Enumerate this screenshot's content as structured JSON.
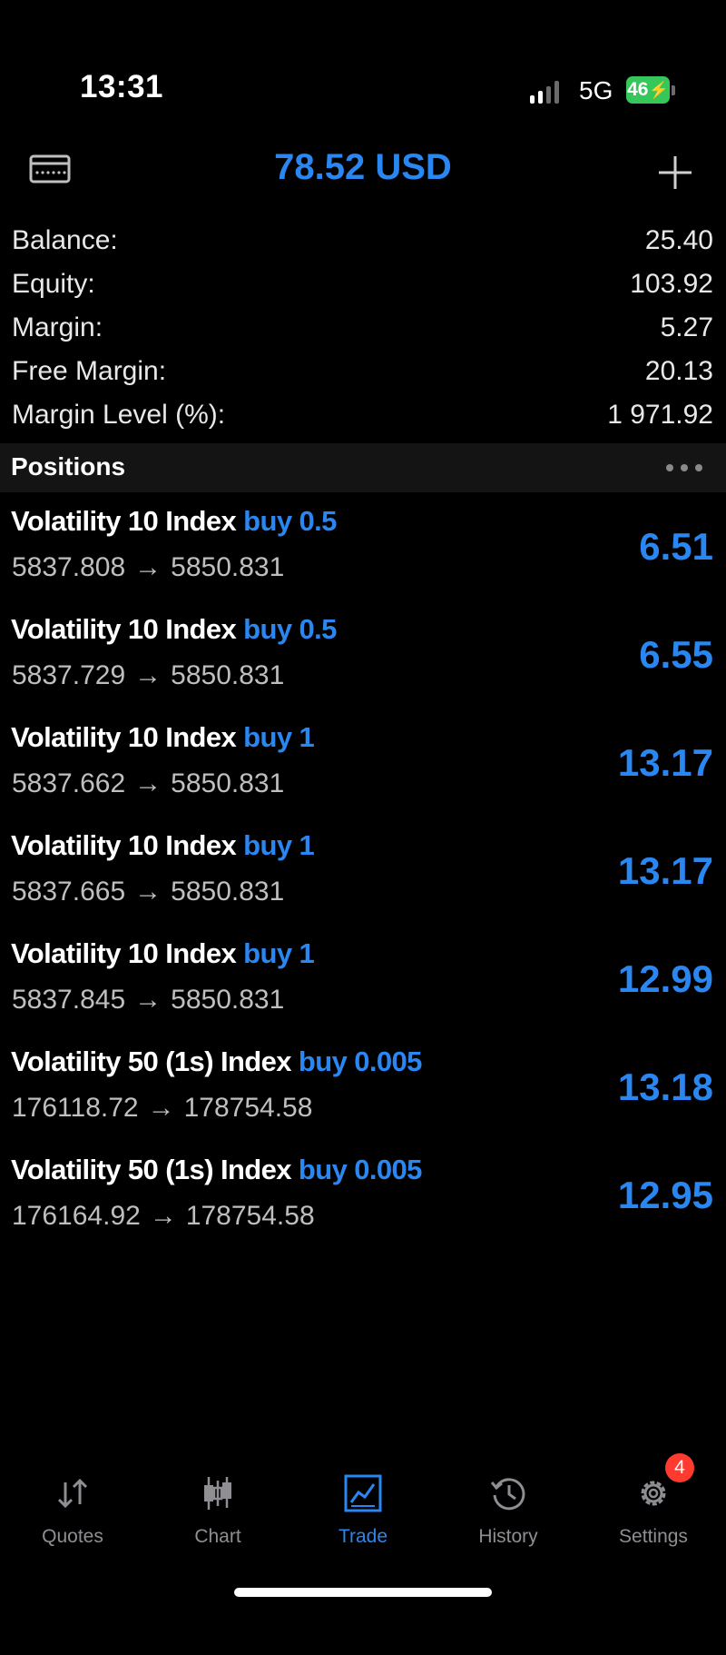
{
  "status_bar": {
    "time": "13:31",
    "network": "5G",
    "battery": "46"
  },
  "header": {
    "title": "78.52 USD",
    "left_icon": "card-icon",
    "right_icon": "plus-icon"
  },
  "summary": [
    {
      "label": "Balance:",
      "value": "25.40"
    },
    {
      "label": "Equity:",
      "value": "103.92"
    },
    {
      "label": "Margin:",
      "value": "5.27"
    },
    {
      "label": "Free Margin:",
      "value": "20.13"
    },
    {
      "label": "Margin Level (%):",
      "value": "1 971.92"
    }
  ],
  "positions": {
    "title": "Positions",
    "more_icon": "more-icon",
    "arrow": "→",
    "items": [
      {
        "symbol": "Volatility 10 Index",
        "side": "buy 0.5",
        "open": "5837.808",
        "current": "5850.831",
        "profit": "6.51"
      },
      {
        "symbol": "Volatility 10 Index",
        "side": "buy 0.5",
        "open": "5837.729",
        "current": "5850.831",
        "profit": "6.55"
      },
      {
        "symbol": "Volatility 10 Index",
        "side": "buy 1",
        "open": "5837.662",
        "current": "5850.831",
        "profit": "13.17"
      },
      {
        "symbol": "Volatility 10 Index",
        "side": "buy 1",
        "open": "5837.665",
        "current": "5850.831",
        "profit": "13.17"
      },
      {
        "symbol": "Volatility 10 Index",
        "side": "buy 1",
        "open": "5837.845",
        "current": "5850.831",
        "profit": "12.99"
      },
      {
        "symbol": "Volatility 50 (1s) Index",
        "side": "buy 0.005",
        "open": "176118.72",
        "current": "178754.58",
        "profit": "13.18"
      },
      {
        "symbol": "Volatility 50 (1s) Index",
        "side": "buy 0.005",
        "open": "176164.92",
        "current": "178754.58",
        "profit": "12.95"
      }
    ]
  },
  "tab_bar": {
    "tabs": [
      {
        "label": "Quotes",
        "icon": "quotes-icon"
      },
      {
        "label": "Chart",
        "icon": "chart-icon"
      },
      {
        "label": "Trade",
        "icon": "trade-icon",
        "active": true
      },
      {
        "label": "History",
        "icon": "history-icon"
      },
      {
        "label": "Settings",
        "icon": "settings-icon",
        "badge": "4"
      }
    ]
  },
  "colors": {
    "accent": "#2a86f0",
    "background": "#000000",
    "badge": "#ff3b30",
    "battery": "#35c759"
  }
}
